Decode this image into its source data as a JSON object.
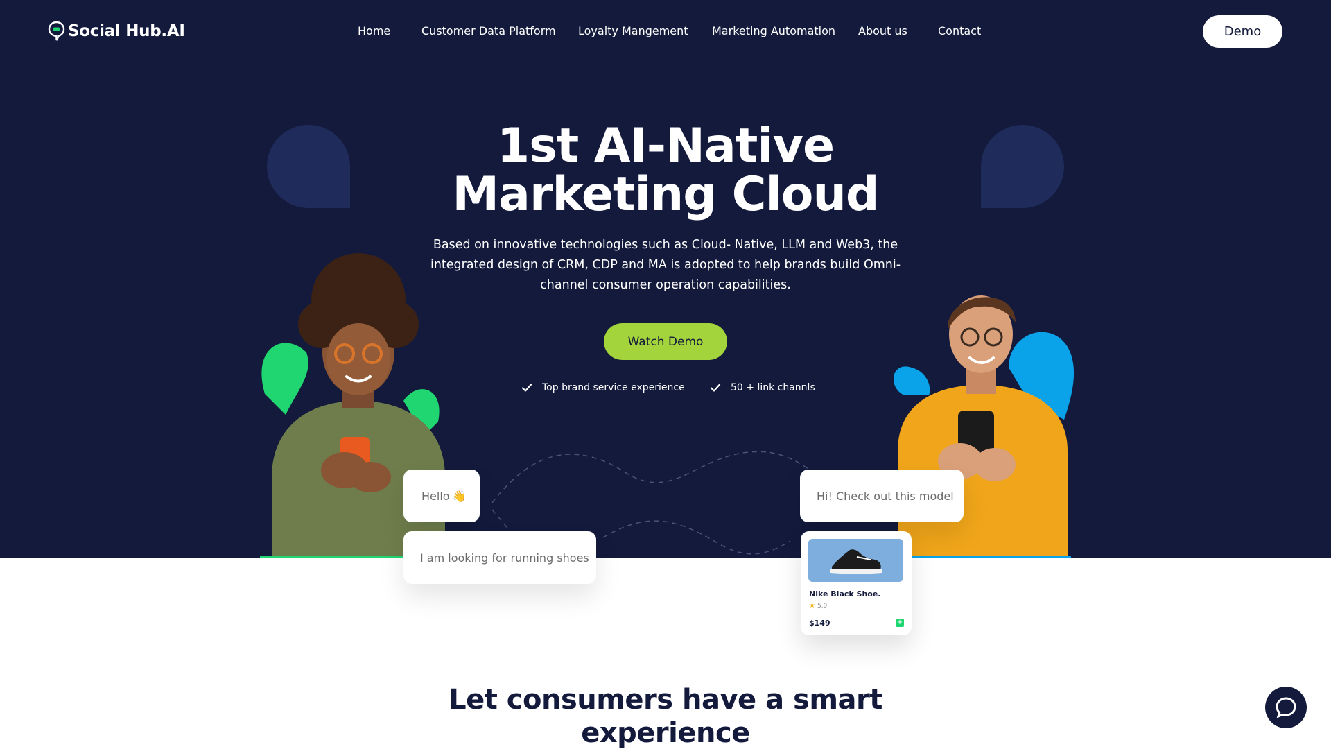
{
  "header": {
    "logo_text": "Social Hub.AI",
    "nav": [
      {
        "label": "Home"
      },
      {
        "label": "Customer Data Platform"
      },
      {
        "label": "Loyalty Mangement"
      },
      {
        "label": "Marketing Automation"
      },
      {
        "label": "About us"
      },
      {
        "label": "Contact"
      }
    ],
    "demo_label": "Demo"
  },
  "hero": {
    "title_line1": "1st AI-Native",
    "title_line2": "Marketing Cloud",
    "subtitle": "Based on innovative technologies such as Cloud- Native, LLM and Web3, the integrated design of CRM, CDP and MA is adopted to help brands build Omni-channel consumer operation capabilities.",
    "cta_label": "Watch Demo",
    "features": [
      {
        "label": "Top brand service experience",
        "icon": "check-icon"
      },
      {
        "label": "50 + link channls",
        "icon": "check-icon"
      }
    ]
  },
  "chat": {
    "hello": "Hello",
    "hello_emoji": "👋",
    "looking": "I am looking for running shoes",
    "reply": "Hi! Check out this model"
  },
  "product": {
    "name": "Nike Black Shoe.",
    "rating": "5.0",
    "price": "$149",
    "add_icon": "plus-icon"
  },
  "section": {
    "title_line1": "Let consumers have a smart",
    "title_line2": "experience"
  },
  "colors": {
    "navy": "#131a3c",
    "lime": "#a4d43c",
    "green": "#1fd670",
    "blue": "#0aa2e8",
    "blob": "#1f2b5a"
  }
}
